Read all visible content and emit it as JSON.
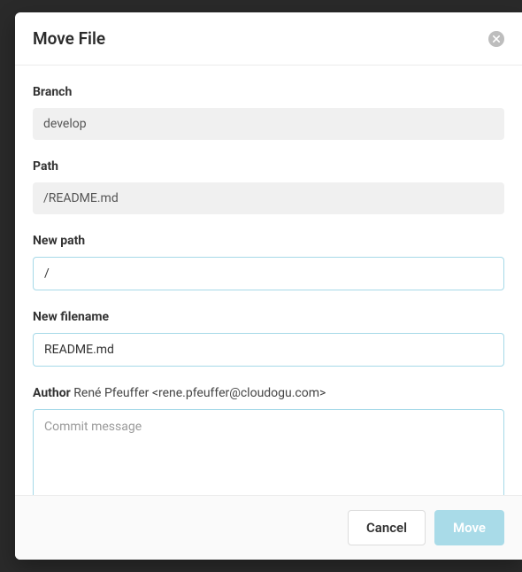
{
  "modal": {
    "title": "Move File",
    "branch": {
      "label": "Branch",
      "value": "develop"
    },
    "path": {
      "label": "Path",
      "value": "/README.md"
    },
    "newPath": {
      "label": "New path",
      "value": "/"
    },
    "newFilename": {
      "label": "New filename",
      "value": "README.md"
    },
    "author": {
      "label": "Author",
      "value": "René Pfeuffer <rene.pfeuffer@cloudogu.com>"
    },
    "commitMessage": {
      "placeholder": "Commit message",
      "value": ""
    },
    "buttons": {
      "cancel": "Cancel",
      "submit": "Move"
    }
  }
}
